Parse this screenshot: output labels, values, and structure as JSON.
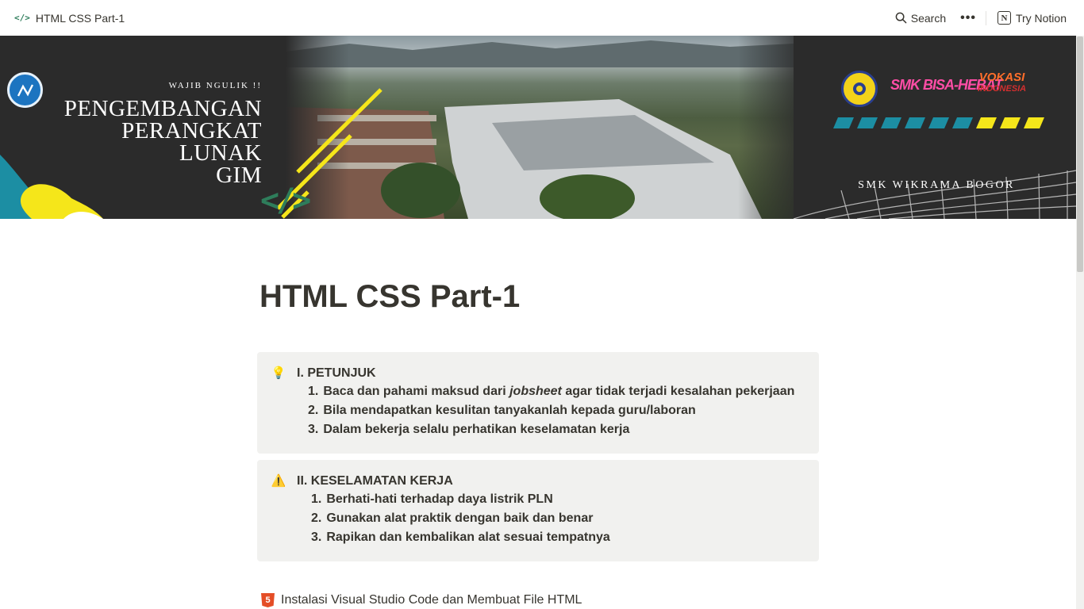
{
  "topbar": {
    "page_title": "HTML CSS Part-1",
    "page_icon_glyph": "</>",
    "search_label": "Search",
    "more_glyph": "•••",
    "try_label": "Try Notion",
    "notion_logo_glyph": "N"
  },
  "banner": {
    "tagline": "WAJIB NGULIK !!",
    "title_lines": [
      "PENGEMBANGAN",
      "PERANGKAT",
      "LUNAK",
      "GIM"
    ],
    "school": "SMK WIKRAMA BOGOR",
    "brand_smk": "SMK BISA-HEBAT",
    "brand_vokasi_lines": [
      "VOKASI",
      "INDONESIA"
    ],
    "page_icon_glyph": "</>"
  },
  "page": {
    "title": "HTML CSS Part-1",
    "callouts": [
      {
        "icon": "lightbulb-icon",
        "icon_glyph": "💡",
        "heading": "I. PETUNJUK",
        "items": [
          {
            "num": "1.",
            "text_before": "Baca dan pahami maksud dari ",
            "text_italic": "jobsheet",
            "text_after": " agar tidak terjadi kesalahan pekerjaan"
          },
          {
            "num": "2.",
            "text": "Bila mendapatkan kesulitan tanyakanlah kepada guru/laboran"
          },
          {
            "num": "3.",
            "text": "Dalam bekerja selalu perhatikan keselamatan kerja"
          }
        ]
      },
      {
        "icon": "warning-icon",
        "icon_glyph": "⚠️",
        "heading": "II. KESELAMATAN KERJA",
        "items": [
          {
            "num": "1.",
            "text": "Berhati-hati terhadap daya listrik PLN"
          },
          {
            "num": "2.",
            "text": "Gunakan alat praktik dengan baik dan benar"
          },
          {
            "num": "3.",
            "text": "Rapikan dan kembalikan alat sesuai tempatnya"
          }
        ]
      }
    ],
    "link": {
      "icon": "html5-icon",
      "icon_glyph": "5",
      "label": "Instalasi Visual Studio Code dan Membuat File HTML"
    }
  },
  "colors": {
    "accent_green": "#2e7d5b",
    "callout_bg": "#f1f1ef",
    "text": "#37352f",
    "banner_yellow": "#f5e61a",
    "banner_teal": "#1c8ea3"
  }
}
